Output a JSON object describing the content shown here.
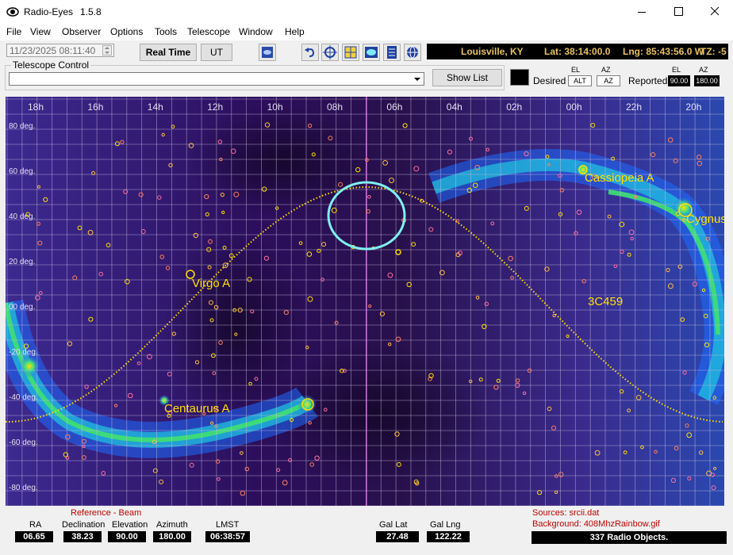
{
  "window": {
    "app_name": "Radio-Eyes",
    "version": "1.5.8"
  },
  "menu": [
    "File",
    "View",
    "Observer",
    "Options",
    "Tools",
    "Telescope",
    "Window",
    "Help"
  ],
  "toolbar": {
    "datetime": "11/23/2025  08:11:40",
    "real_time_label": "Real Time",
    "ut_label": "UT",
    "location": "Louisville, KY",
    "lat": "Lat: 38:14:00.0",
    "lng": "Lng: 85:43:56.0 W",
    "tz": "TZ: -5"
  },
  "telescope": {
    "group_label": "Telescope Control",
    "show_list_label": "Show List",
    "desired_label": "Desired",
    "reported_label": "Reported",
    "el_label": "EL",
    "az_label": "AZ",
    "desired_el_value": "ALT",
    "desired_az_value": "AZ",
    "reported_el_value": "90.00",
    "reported_az_value": "180.00"
  },
  "map": {
    "ra_labels": [
      "18h",
      "16h",
      "14h",
      "12h",
      "10h",
      "08h",
      "06h",
      "04h",
      "02h",
      "00h",
      "22h",
      "20h"
    ],
    "dec_labels": [
      "80 deg.",
      "60 deg.",
      "40 deg.",
      "20 deg.",
      "00 deg.",
      "-20 deg.",
      "-40 deg.",
      "-60 deg.",
      "-80 deg."
    ],
    "sources": [
      "Cassiopeia A",
      "Cygnus",
      "Virgo A",
      "3C459",
      "Centaurus A"
    ]
  },
  "status": {
    "reference_beam": "Reference - Beam",
    "ra_label": "RA",
    "ra_value": "06.65",
    "dec_label": "Declination",
    "dec_value": "38.23",
    "elev_label": "Elevation",
    "elev_value": "90.00",
    "az_label": "Azimuth",
    "az_value": "180.00",
    "lmst_label": "LMST",
    "lmst_value": "06:38:57",
    "glat_label": "Gal Lat",
    "glat_value": "27.48",
    "glng_label": "Gal Lng",
    "glng_value": "122.22",
    "sources_file": "Sources: srcii.dat",
    "background_file": "Background: 408MhzRainbow.gif",
    "object_count": "337 Radio Objects."
  },
  "colors": {
    "accent_yellow": "#ffe000",
    "beam_cyan": "#7ff0f0",
    "map_violet": "#3a1a7a"
  }
}
